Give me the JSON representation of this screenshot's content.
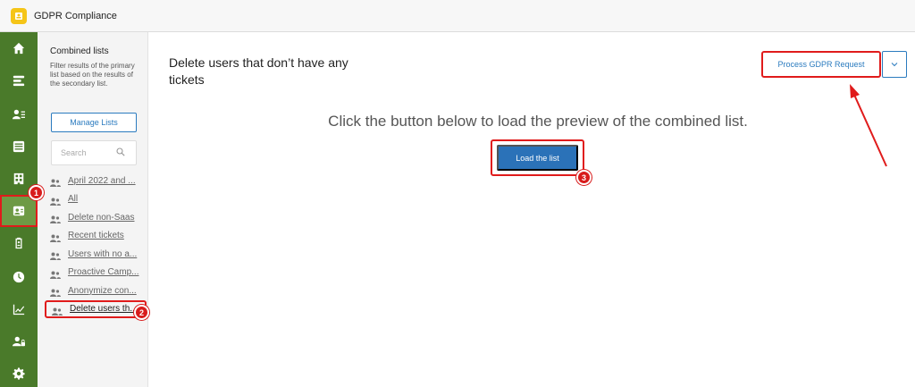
{
  "app": {
    "title": "GDPR Compliance"
  },
  "rail": {
    "items": [
      {
        "icon": "home-icon"
      },
      {
        "icon": "list-icon"
      },
      {
        "icon": "users-icon"
      },
      {
        "icon": "inbox-icon"
      },
      {
        "icon": "building-icon"
      },
      {
        "icon": "gdpr-user-icon",
        "active": true
      },
      {
        "icon": "clipboard-icon"
      },
      {
        "icon": "clock-icon"
      },
      {
        "icon": "chart-icon"
      },
      {
        "icon": "user-lock-icon"
      },
      {
        "icon": "gear-icon"
      }
    ]
  },
  "panel": {
    "title": "Combined lists",
    "description": "Filter results of the primary list based on the results of the secondary list.",
    "manage_label": "Manage Lists",
    "search_placeholder": "Search",
    "items": [
      "April 2022 and ...",
      "All",
      "Delete non-Saas",
      "Recent tickets",
      "Users with no a...",
      "Proactive Camp...",
      "Anonymize con...",
      "Delete users th..."
    ],
    "selected_index": 7
  },
  "main": {
    "title": "Delete users that don’t have any tickets",
    "process_label": "Process GDPR Request",
    "hint": "Click the button below to load the preview of the combined list.",
    "load_label": "Load the list"
  },
  "annotations": {
    "badge1": "1",
    "badge2": "2",
    "badge3": "3"
  },
  "colors": {
    "rail": "#4a7a2a",
    "accent": "#2b72b8",
    "highlight": "#e01b1b"
  }
}
